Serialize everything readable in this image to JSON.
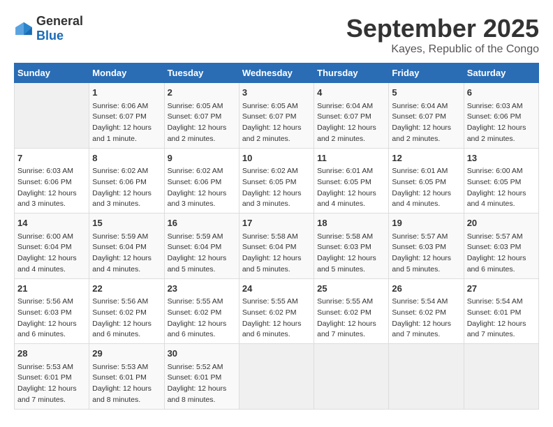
{
  "header": {
    "logo_general": "General",
    "logo_blue": "Blue",
    "main_title": "September 2025",
    "subtitle": "Kayes, Republic of the Congo"
  },
  "days_of_week": [
    "Sunday",
    "Monday",
    "Tuesday",
    "Wednesday",
    "Thursday",
    "Friday",
    "Saturday"
  ],
  "weeks": [
    [
      {
        "num": "",
        "info": ""
      },
      {
        "num": "1",
        "info": "Sunrise: 6:06 AM\nSunset: 6:07 PM\nDaylight: 12 hours\nand 1 minute."
      },
      {
        "num": "2",
        "info": "Sunrise: 6:05 AM\nSunset: 6:07 PM\nDaylight: 12 hours\nand 2 minutes."
      },
      {
        "num": "3",
        "info": "Sunrise: 6:05 AM\nSunset: 6:07 PM\nDaylight: 12 hours\nand 2 minutes."
      },
      {
        "num": "4",
        "info": "Sunrise: 6:04 AM\nSunset: 6:07 PM\nDaylight: 12 hours\nand 2 minutes."
      },
      {
        "num": "5",
        "info": "Sunrise: 6:04 AM\nSunset: 6:07 PM\nDaylight: 12 hours\nand 2 minutes."
      },
      {
        "num": "6",
        "info": "Sunrise: 6:03 AM\nSunset: 6:06 PM\nDaylight: 12 hours\nand 2 minutes."
      }
    ],
    [
      {
        "num": "7",
        "info": "Sunrise: 6:03 AM\nSunset: 6:06 PM\nDaylight: 12 hours\nand 3 minutes."
      },
      {
        "num": "8",
        "info": "Sunrise: 6:02 AM\nSunset: 6:06 PM\nDaylight: 12 hours\nand 3 minutes."
      },
      {
        "num": "9",
        "info": "Sunrise: 6:02 AM\nSunset: 6:06 PM\nDaylight: 12 hours\nand 3 minutes."
      },
      {
        "num": "10",
        "info": "Sunrise: 6:02 AM\nSunset: 6:05 PM\nDaylight: 12 hours\nand 3 minutes."
      },
      {
        "num": "11",
        "info": "Sunrise: 6:01 AM\nSunset: 6:05 PM\nDaylight: 12 hours\nand 4 minutes."
      },
      {
        "num": "12",
        "info": "Sunrise: 6:01 AM\nSunset: 6:05 PM\nDaylight: 12 hours\nand 4 minutes."
      },
      {
        "num": "13",
        "info": "Sunrise: 6:00 AM\nSunset: 6:05 PM\nDaylight: 12 hours\nand 4 minutes."
      }
    ],
    [
      {
        "num": "14",
        "info": "Sunrise: 6:00 AM\nSunset: 6:04 PM\nDaylight: 12 hours\nand 4 minutes."
      },
      {
        "num": "15",
        "info": "Sunrise: 5:59 AM\nSunset: 6:04 PM\nDaylight: 12 hours\nand 4 minutes."
      },
      {
        "num": "16",
        "info": "Sunrise: 5:59 AM\nSunset: 6:04 PM\nDaylight: 12 hours\nand 5 minutes."
      },
      {
        "num": "17",
        "info": "Sunrise: 5:58 AM\nSunset: 6:04 PM\nDaylight: 12 hours\nand 5 minutes."
      },
      {
        "num": "18",
        "info": "Sunrise: 5:58 AM\nSunset: 6:03 PM\nDaylight: 12 hours\nand 5 minutes."
      },
      {
        "num": "19",
        "info": "Sunrise: 5:57 AM\nSunset: 6:03 PM\nDaylight: 12 hours\nand 5 minutes."
      },
      {
        "num": "20",
        "info": "Sunrise: 5:57 AM\nSunset: 6:03 PM\nDaylight: 12 hours\nand 6 minutes."
      }
    ],
    [
      {
        "num": "21",
        "info": "Sunrise: 5:56 AM\nSunset: 6:03 PM\nDaylight: 12 hours\nand 6 minutes."
      },
      {
        "num": "22",
        "info": "Sunrise: 5:56 AM\nSunset: 6:02 PM\nDaylight: 12 hours\nand 6 minutes."
      },
      {
        "num": "23",
        "info": "Sunrise: 5:55 AM\nSunset: 6:02 PM\nDaylight: 12 hours\nand 6 minutes."
      },
      {
        "num": "24",
        "info": "Sunrise: 5:55 AM\nSunset: 6:02 PM\nDaylight: 12 hours\nand 6 minutes."
      },
      {
        "num": "25",
        "info": "Sunrise: 5:55 AM\nSunset: 6:02 PM\nDaylight: 12 hours\nand 7 minutes."
      },
      {
        "num": "26",
        "info": "Sunrise: 5:54 AM\nSunset: 6:02 PM\nDaylight: 12 hours\nand 7 minutes."
      },
      {
        "num": "27",
        "info": "Sunrise: 5:54 AM\nSunset: 6:01 PM\nDaylight: 12 hours\nand 7 minutes."
      }
    ],
    [
      {
        "num": "28",
        "info": "Sunrise: 5:53 AM\nSunset: 6:01 PM\nDaylight: 12 hours\nand 7 minutes."
      },
      {
        "num": "29",
        "info": "Sunrise: 5:53 AM\nSunset: 6:01 PM\nDaylight: 12 hours\nand 8 minutes."
      },
      {
        "num": "30",
        "info": "Sunrise: 5:52 AM\nSunset: 6:01 PM\nDaylight: 12 hours\nand 8 minutes."
      },
      {
        "num": "",
        "info": ""
      },
      {
        "num": "",
        "info": ""
      },
      {
        "num": "",
        "info": ""
      },
      {
        "num": "",
        "info": ""
      }
    ]
  ]
}
